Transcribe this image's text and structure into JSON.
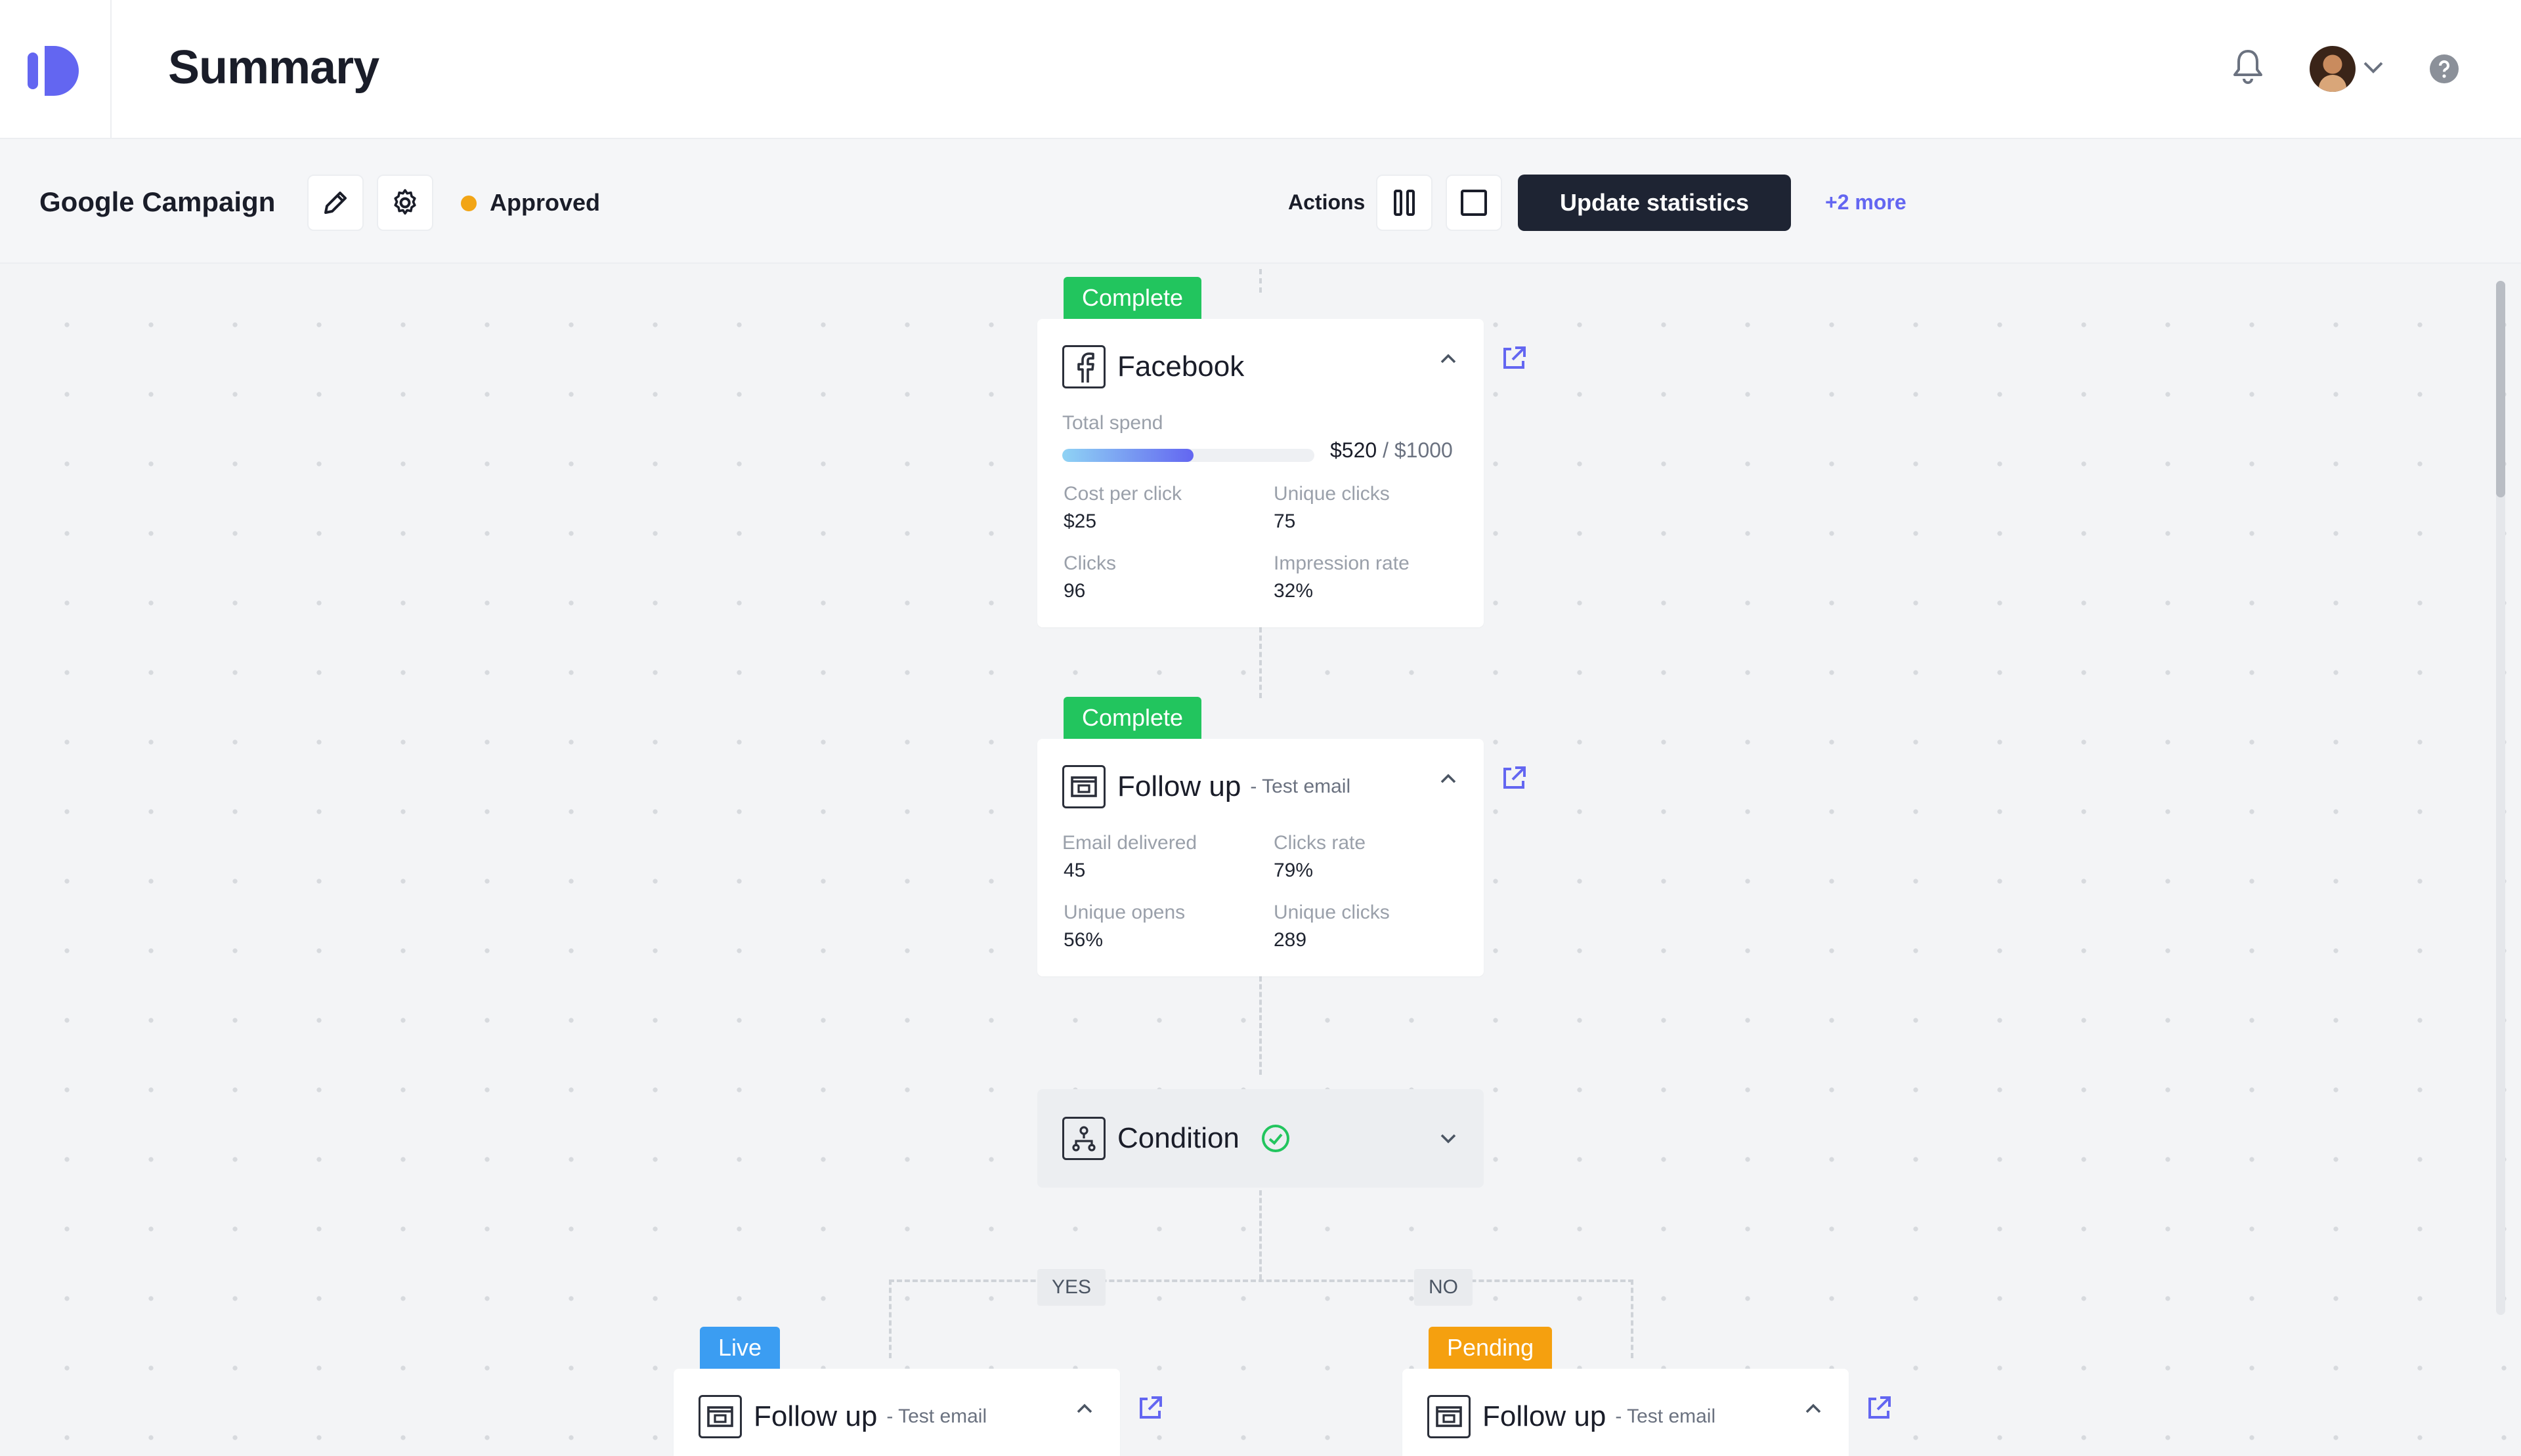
{
  "header": {
    "title": "Summary",
    "icons": {
      "logo": "app-logo",
      "notifications": "bell-icon",
      "avatar_chevron": "chevron-down-icon",
      "help": "help-icon"
    }
  },
  "subheader": {
    "campaign_name": "Google Campaign",
    "status": "Approved",
    "status_color": "#f2a516",
    "actions_label": "Actions",
    "update_button": "Update statistics",
    "more_link": "+2 more"
  },
  "flow": {
    "facebook": {
      "badge": "Complete",
      "title": "Facebook",
      "spend_label": "Total spend",
      "spend_value": "$520",
      "spend_total": " / $1000",
      "spend_fraction": 0.52,
      "metrics": [
        {
          "label": "Cost per click",
          "value": "$25"
        },
        {
          "label": "Unique clicks",
          "value": "75"
        },
        {
          "label": "Clicks",
          "value": "96"
        },
        {
          "label": "Impression rate",
          "value": "32%"
        }
      ]
    },
    "followup": {
      "badge": "Complete",
      "title": "Follow up",
      "subtitle": "- Test email",
      "metrics": [
        {
          "label": "Email delivered",
          "value": "45"
        },
        {
          "label": "Clicks rate",
          "value": "79%"
        },
        {
          "label": "Unique opens",
          "value": "56%"
        },
        {
          "label": "Unique clicks",
          "value": "289"
        }
      ]
    },
    "condition": {
      "title": "Condition"
    },
    "branches": {
      "yes": "YES",
      "no": "NO"
    },
    "yes_card": {
      "badge": "Live",
      "title": "Follow up",
      "subtitle": "- Test email"
    },
    "no_card": {
      "badge": "Pending",
      "title": "Follow up",
      "subtitle": "- Test email"
    }
  },
  "colors": {
    "complete": "#22c55e",
    "live": "#3b9df2",
    "pending": "#f5a00f",
    "accent": "#6366f1",
    "primary": "#1e2433"
  }
}
